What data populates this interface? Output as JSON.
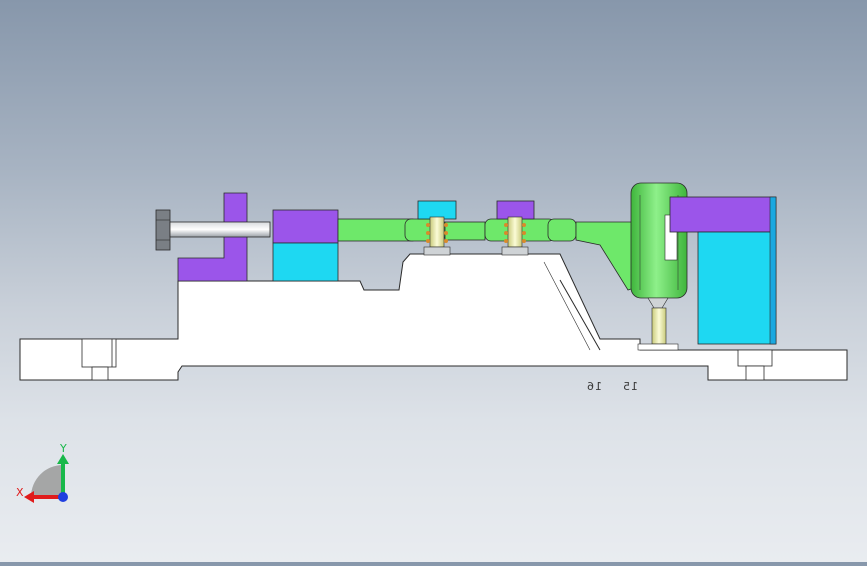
{
  "viewport": {
    "background_top": "#8797ab",
    "background_bottom": "#e9ecf0"
  },
  "model": {
    "colors": {
      "green_part": "#6ee86a",
      "green_part_dark": "#3fb53c",
      "purple_block": "#9b55ea",
      "cyan_block": "#1ed8f2",
      "cyan_dark": "#1aa8e0",
      "base_plate": "#ffffff",
      "edge": "#2b2b2b",
      "yellow_pin": "#f1f2b4",
      "bolt_grey": "#9aa0a6"
    },
    "annotations": [
      {
        "text": "15"
      },
      {
        "text": "16"
      }
    ]
  },
  "triad": {
    "x_label": "X",
    "y_label": "Y",
    "x_color": "#e01b1b",
    "y_color": "#18b84a",
    "z_color": "#1f3fe0"
  }
}
